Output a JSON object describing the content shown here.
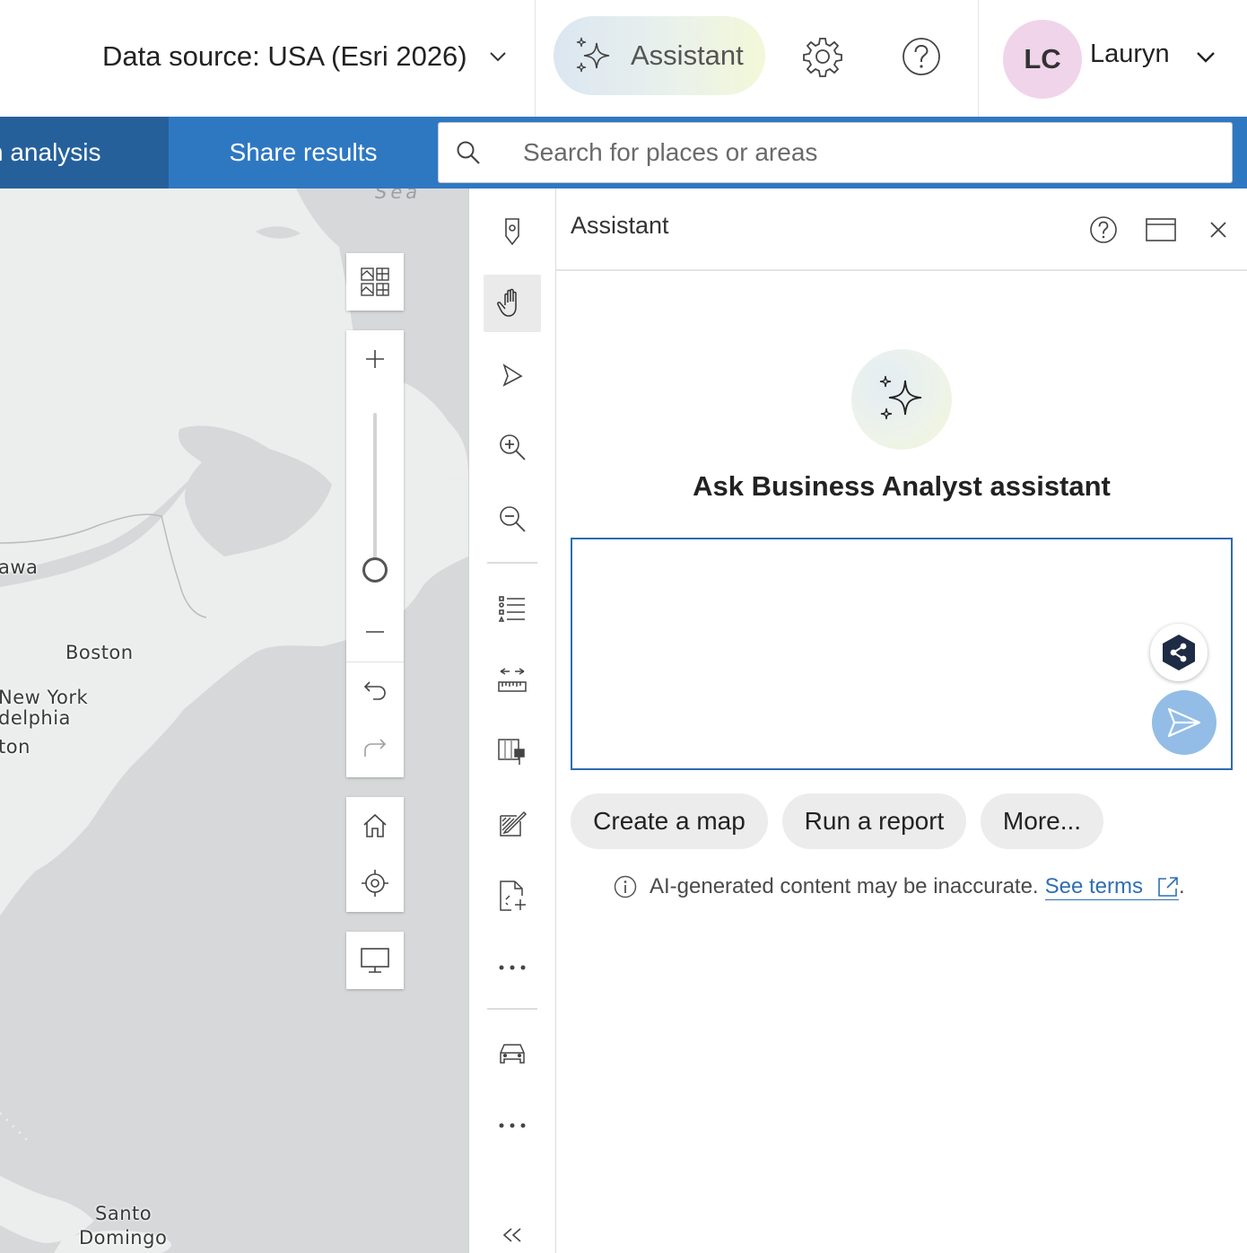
{
  "header": {
    "data_source_label": "Data source: USA (Esri 2026)",
    "assistant_label": "Assistant",
    "user_initials": "LC",
    "user_name": "Lauryn",
    "avatar_color": "#f0d4ea"
  },
  "nav": {
    "tabs": [
      {
        "label": "n analysis",
        "active": true
      },
      {
        "label": "Share results",
        "active": false
      }
    ],
    "search_placeholder": "Search for places or areas"
  },
  "map": {
    "labels": {
      "sea": "Sea",
      "ottawa": "awa",
      "boston": "Boston",
      "new_york": "New York",
      "philadelphia": "delphia",
      "washington": "ton",
      "santo": "Santo",
      "domingo": "Domingo"
    },
    "controls": [
      "basemap-gallery-icon",
      "zoom-in-icon",
      "zoom-slider",
      "zoom-out-icon",
      "undo-icon",
      "redo-icon",
      "home-icon",
      "locate-icon",
      "fullscreen-icon"
    ]
  },
  "tools": [
    "pin-icon",
    "pan-icon",
    "select-icon",
    "zoom-in-icon",
    "zoom-out-icon",
    "legend-list-icon",
    "measure-icon",
    "layer-style-icon",
    "sketch-icon",
    "add-data-icon",
    "more-icon",
    "drive-time-icon",
    "more-icon",
    "collapse-icon"
  ],
  "panel": {
    "title": "Assistant",
    "ask_title": "Ask Business Analyst assistant",
    "prompt_value": "",
    "chips": [
      "Create a map",
      "Run a report",
      "More..."
    ],
    "disclaimer": "AI-generated content may be inaccurate.",
    "terms_link": "See terms",
    "terms_suffix": "."
  },
  "colors": {
    "nav_bar": "#2e78c2",
    "nav_active": "#25609b",
    "prompt_border": "#2e6bb0",
    "send_button": "#93bde6",
    "link": "#2f6fb0"
  }
}
